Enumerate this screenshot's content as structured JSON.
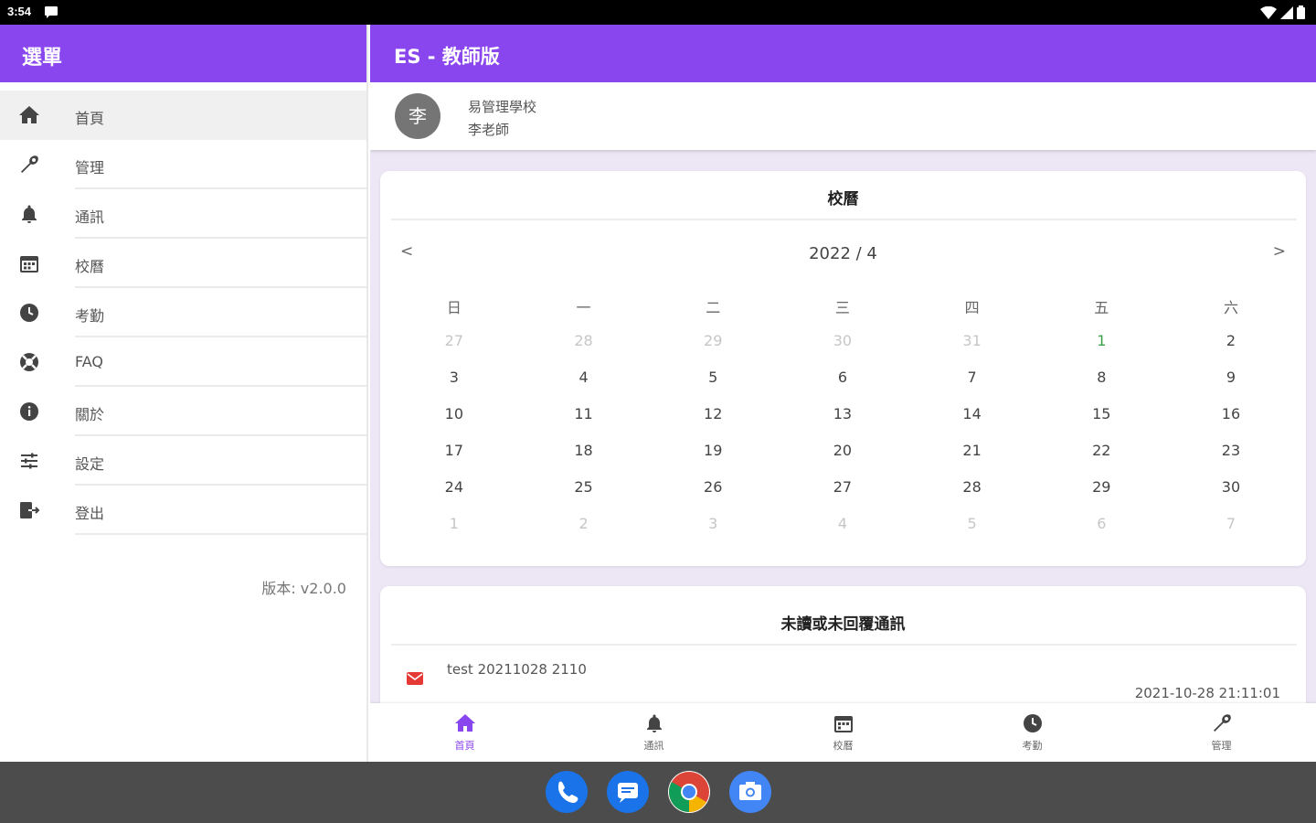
{
  "status": {
    "time": "3:54"
  },
  "drawer": {
    "title": "選單",
    "items": [
      {
        "label": "首頁",
        "icon": "home-icon"
      },
      {
        "label": "管理",
        "icon": "wrench-icon"
      },
      {
        "label": "通訊",
        "icon": "bell-icon"
      },
      {
        "label": "校曆",
        "icon": "calendar-icon"
      },
      {
        "label": "考勤",
        "icon": "clock-icon"
      },
      {
        "label": "FAQ",
        "icon": "lifebuoy-icon"
      },
      {
        "label": "關於",
        "icon": "info-icon"
      },
      {
        "label": "設定",
        "icon": "sliders-icon"
      },
      {
        "label": "登出",
        "icon": "logout-icon"
      }
    ],
    "version": "版本: v2.0.0"
  },
  "appbar": {
    "title": "ES - 教師版"
  },
  "profile": {
    "avatar_text": "李",
    "school": "易管理學校",
    "teacher": "李老師"
  },
  "calendar": {
    "title": "校曆",
    "month": "2022 / 4",
    "prev": "<",
    "next": ">",
    "weekdays": [
      "日",
      "一",
      "二",
      "三",
      "四",
      "五",
      "六"
    ],
    "weeks": [
      [
        "27",
        "28",
        "29",
        "30",
        "31",
        "1",
        "2"
      ],
      [
        "3",
        "4",
        "5",
        "6",
        "7",
        "8",
        "9"
      ],
      [
        "10",
        "11",
        "12",
        "13",
        "14",
        "15",
        "16"
      ],
      [
        "17",
        "18",
        "19",
        "20",
        "21",
        "22",
        "23"
      ],
      [
        "24",
        "25",
        "26",
        "27",
        "28",
        "29",
        "30"
      ],
      [
        "1",
        "2",
        "3",
        "4",
        "5",
        "6",
        "7"
      ]
    ]
  },
  "messages": {
    "title": "未讀或未回覆通訊",
    "items": [
      {
        "text": "test 20211028 2110",
        "time": "2021-10-28 21:11:01",
        "icon": "mail-icon"
      }
    ]
  },
  "bottom_nav": [
    {
      "label": "首頁",
      "icon": "home-icon",
      "active": true
    },
    {
      "label": "通訊",
      "icon": "bell-icon"
    },
    {
      "label": "校曆",
      "icon": "calendar-icon"
    },
    {
      "label": "考勤",
      "icon": "clock-icon"
    },
    {
      "label": "管理",
      "icon": "wrench-icon"
    }
  ],
  "dock": [
    {
      "icon": "phone-icon"
    },
    {
      "icon": "messages-icon"
    },
    {
      "icon": "chrome-icon"
    },
    {
      "icon": "camera-icon"
    }
  ],
  "colors": {
    "accent": "#8a46ee",
    "today": "#3aa24a",
    "mail": "#e53935"
  }
}
